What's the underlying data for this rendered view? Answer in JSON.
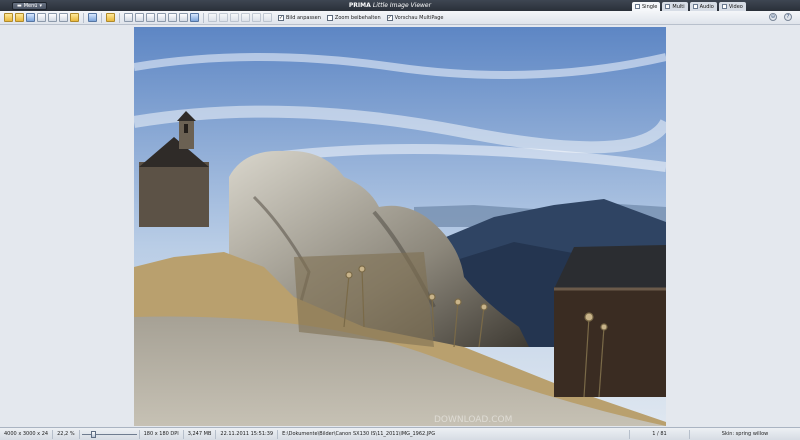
{
  "titlebar": {
    "menu_label": "Menü",
    "app_name": "PRIMA",
    "app_subtitle": "Little Image Viewer",
    "tabs": [
      {
        "label": "Single",
        "active": true
      },
      {
        "label": "Multi",
        "active": false
      },
      {
        "label": "Audio",
        "active": false
      },
      {
        "label": "Video",
        "active": false
      }
    ]
  },
  "toolbar": {
    "fit_label": "Bild anpassen",
    "fit_checked": true,
    "zoom_keep_label": "Zoom beibehalten",
    "zoom_keep_checked": false,
    "multipage_label": "Vorschau MultiPage",
    "multipage_checked": true
  },
  "statusbar": {
    "dimensions": "4000 x 3000 x 24",
    "zoom": "22,2 %",
    "zoom_level": 0.2,
    "dpi": "180 x 180 DPI",
    "size": "3,247 MB",
    "date": "22.11.2011 15:51:39",
    "path": "E:\\Dokumente\\Bilder\\Canon SX130 IS\\11_2011\\IMG_1962.JPG",
    "page": "1 / 81",
    "skin": "Skin: spring willow"
  },
  "watermark": "DOWNLOAD.COM",
  "colors": {
    "accent": "#2a3039",
    "sky": "#5d86c4",
    "ground": "#a89a78"
  }
}
